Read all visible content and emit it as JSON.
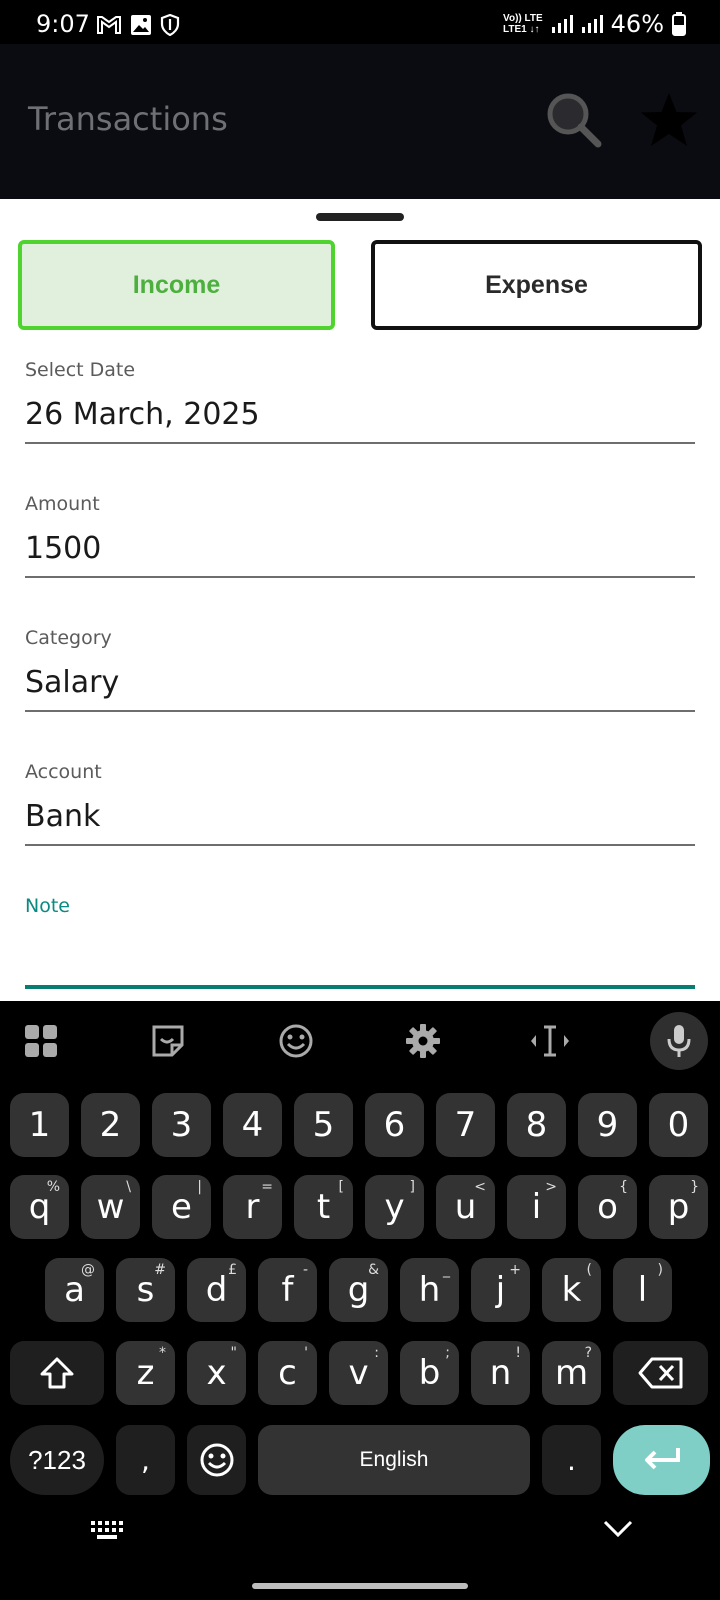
{
  "status_bar": {
    "time": "9:07",
    "battery": "46%",
    "network_top": "Vo)) LTE",
    "network_bottom": "LTE1 ↓↑"
  },
  "app_bar": {
    "title": "Transactions"
  },
  "sheet": {
    "income_label": "Income",
    "expense_label": "Expense",
    "fields": [
      {
        "label": "Select Date",
        "value": "26 March, 2025"
      },
      {
        "label": "Amount",
        "value": "1500"
      },
      {
        "label": "Category",
        "value": "Salary"
      },
      {
        "label": "Account",
        "value": "Bank"
      },
      {
        "label": "Note",
        "value": ""
      }
    ]
  },
  "keyboard": {
    "numbers": [
      "1",
      "2",
      "3",
      "4",
      "5",
      "6",
      "7",
      "8",
      "9",
      "0"
    ],
    "row1": [
      "q",
      "w",
      "e",
      "r",
      "t",
      "y",
      "u",
      "i",
      "o",
      "p"
    ],
    "row1_hints": [
      "%",
      "\\",
      "|",
      "=",
      "[",
      "]",
      "<",
      ">",
      "{",
      "}"
    ],
    "row2": [
      "a",
      "s",
      "d",
      "f",
      "g",
      "h",
      "j",
      "k",
      "l"
    ],
    "row2_hints": [
      "@",
      "#",
      "£",
      "-",
      "&",
      "_",
      "+",
      "(",
      ")"
    ],
    "row3": [
      "z",
      "x",
      "c",
      "v",
      "b",
      "n",
      "m"
    ],
    "row3_hints": [
      "*",
      "\"",
      "'",
      ":",
      ";",
      "!",
      "?"
    ],
    "symbols_label": "?123",
    "comma": ",",
    "space_label": "English",
    "period": "."
  },
  "colors": {
    "income_green": "#4caf3e",
    "note_teal": "#0a8a80",
    "enter_key": "#7fcfc6"
  }
}
